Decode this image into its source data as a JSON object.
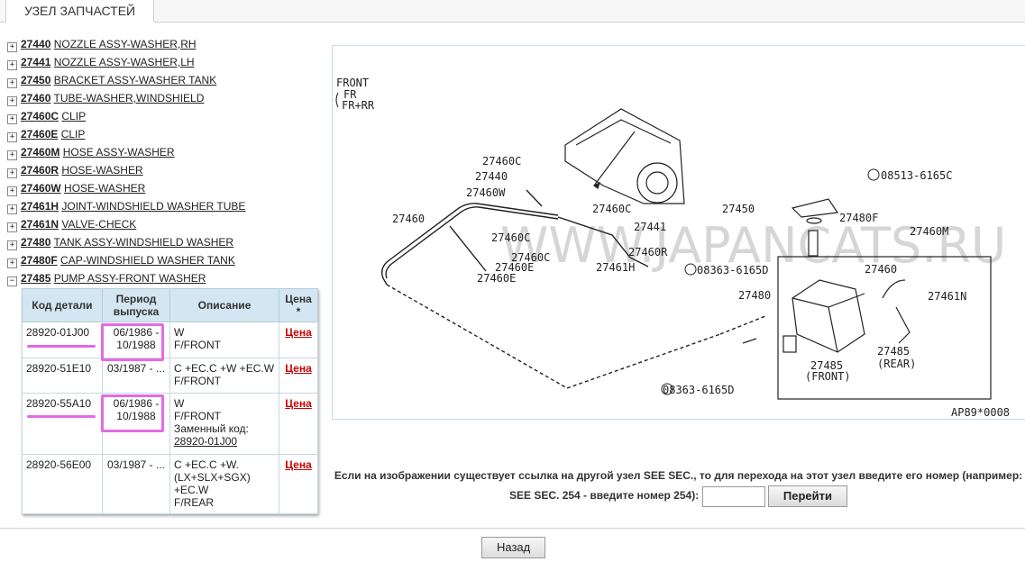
{
  "tab": "УЗЕЛ ЗАПЧАСТЕЙ",
  "tree": [
    {
      "code": "27440",
      "name": "NOZZLE ASSY-WASHER,RH",
      "toggle": "+"
    },
    {
      "code": "27441",
      "name": "NOZZLE ASSY-WASHER,LH",
      "toggle": "+"
    },
    {
      "code": "27450",
      "name": "BRACKET ASSY-WASHER TANK",
      "toggle": "+"
    },
    {
      "code": "27460",
      "name": "TUBE-WASHER,WINDSHIELD",
      "toggle": "+"
    },
    {
      "code": "27460C",
      "name": "CLIP",
      "toggle": "+"
    },
    {
      "code": "27460E",
      "name": "CLIP",
      "toggle": "+"
    },
    {
      "code": "27460M",
      "name": "HOSE ASSY-WASHER",
      "toggle": "+"
    },
    {
      "code": "27460R",
      "name": "HOSE-WASHER",
      "toggle": "+"
    },
    {
      "code": "27460W",
      "name": "HOSE-WASHER",
      "toggle": "+"
    },
    {
      "code": "27461H",
      "name": "JOINT-WINDSHIELD WASHER TUBE",
      "toggle": "+"
    },
    {
      "code": "27461N",
      "name": "VALVE-CHECK",
      "toggle": "+"
    },
    {
      "code": "27480",
      "name": "TANK ASSY-WINDSHIELD WASHER",
      "toggle": "+"
    },
    {
      "code": "27480F",
      "name": "CAP-WINDSHIELD WASHER TANK",
      "toggle": "+"
    },
    {
      "code": "27485",
      "name": "PUMP ASSY-FRONT WASHER",
      "toggle": "−"
    }
  ],
  "table": {
    "headers": {
      "code": "Код детали",
      "period": "Период выпуска",
      "desc": "Описание",
      "price": "Цена *"
    },
    "rows": [
      {
        "code": "28920-01J00",
        "period": "06/1986 - 10/1988",
        "desc": [
          "W",
          "F/FRONT"
        ],
        "price": "Цена"
      },
      {
        "code": "28920-51E10",
        "period": "03/1987 - ...",
        "desc": [
          "C +EC.C +W +EC.W",
          "F/FRONT"
        ],
        "price": "Цена"
      },
      {
        "code": "28920-55A10",
        "period": "06/1986 - 10/1988",
        "desc": [
          "W",
          "F/FRONT",
          "Заменный код:"
        ],
        "subst": "28920-01J00",
        "price": "Цена"
      },
      {
        "code": "28920-56E00",
        "period": "03/1987 - ...",
        "desc": [
          "C +EC.C +W.",
          "(LX+SLX+SGX)",
          "+EC.W",
          "F/REAR"
        ],
        "price": "Цена"
      }
    ]
  },
  "diagram": {
    "front_label": "FRONT",
    "fr": "FR",
    "frrr": "FR+RR",
    "watermark": "WWW.JAPANCATS.RU",
    "ref": "AP89*0008",
    "labels": {
      "l27460c_a": "27460C",
      "l27440": "27440",
      "l27460w": "27460W",
      "l27460": "27460",
      "l27460c_b": "27460C",
      "l27460c_c": "27460C",
      "l27460c_d": "27460C",
      "l27460e": "27460E",
      "l27460e2": "27460E",
      "l27461h": "27461H",
      "l27441": "27441",
      "l27460r": "27460R",
      "l08513": "08513-6165C",
      "l27450": "27450",
      "l27480f": "27480F",
      "l27460m": "27460M",
      "l08363a": "08363-6165D",
      "l27460b": "27460",
      "l27480": "27480",
      "l27461n": "27461N",
      "l27485r": "27485",
      "rear": "(REAR)",
      "l27485f": "27485",
      "front": "(FRONT)",
      "l08363b": "08363-6165D"
    }
  },
  "hint": {
    "line1": "Если на изображении существует ссылка на другой узел SEE SEC., то для перехода на этот узел введите его номер (например:",
    "line2": "SEE SEC. 254 - введите номер 254):",
    "input_value": "",
    "go": "Перейти"
  },
  "back": "Назад"
}
